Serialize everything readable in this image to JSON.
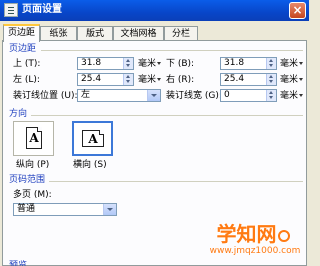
{
  "window": {
    "title": "页面设置",
    "close_label": "×"
  },
  "tabs": [
    {
      "label": "页边距",
      "active": true
    },
    {
      "label": "纸张",
      "active": false
    },
    {
      "label": "版式",
      "active": false
    },
    {
      "label": "文档网格",
      "active": false
    },
    {
      "label": "分栏",
      "active": false
    }
  ],
  "margins": {
    "section_title": "页边距",
    "top": {
      "label": "上 (T):",
      "value": "31.8",
      "unit": "毫米"
    },
    "bottom": {
      "label": "下 (B):",
      "value": "31.8",
      "unit": "毫米"
    },
    "left": {
      "label": "左 (L):",
      "value": "25.4",
      "unit": "毫米"
    },
    "right": {
      "label": "右 (R):",
      "value": "25.4",
      "unit": "毫米"
    },
    "gutter_pos": {
      "label": "装订线位置 (U):",
      "value": "左"
    },
    "gutter_width": {
      "label": "装订线宽 (G):",
      "value": "0",
      "unit": "毫米"
    }
  },
  "orientation": {
    "section_title": "方向",
    "icon_letter": "A",
    "portrait_label": "纵向 (P)",
    "landscape_label": "横向 (S)",
    "selected": "landscape"
  },
  "pages": {
    "section_title": "页码范围",
    "multi_label": "多页 (M):",
    "multi_value": "普通"
  },
  "preview": {
    "section_title": "预览"
  },
  "watermark": {
    "text": "学知网",
    "url": "www.jmqz1000.com"
  },
  "colors": {
    "title_bar": "#0a4fd8",
    "section_title": "#1f3fbf",
    "accent_tab": "#ffc83c",
    "watermark": "#ff7a12"
  }
}
